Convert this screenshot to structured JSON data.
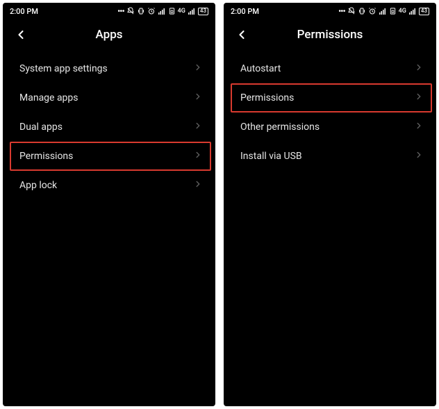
{
  "status": {
    "time": "2:00 PM",
    "battery": "43"
  },
  "screens": [
    {
      "title": "Apps",
      "items": [
        {
          "label": "System app settings",
          "highlight": false
        },
        {
          "label": "Manage apps",
          "highlight": false
        },
        {
          "label": "Dual apps",
          "highlight": false
        },
        {
          "label": "Permissions",
          "highlight": true
        },
        {
          "label": "App lock",
          "highlight": false
        }
      ]
    },
    {
      "title": "Permissions",
      "items": [
        {
          "label": "Autostart",
          "highlight": false
        },
        {
          "label": "Permissions",
          "highlight": true
        },
        {
          "label": "Other permissions",
          "highlight": false
        },
        {
          "label": "Install via USB",
          "highlight": false
        }
      ]
    }
  ]
}
